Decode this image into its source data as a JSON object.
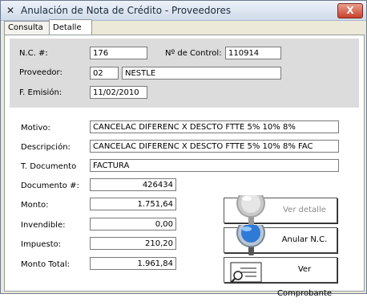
{
  "window": {
    "title": "Anulación de Nota de Crédito - Proveedores",
    "close_label": "X"
  },
  "tabs": [
    {
      "label": "Consulta"
    },
    {
      "label": "Detalle"
    }
  ],
  "header": {
    "nc_label": "N.C. #:",
    "nc_value": "176",
    "control_label": "Nº de Control:",
    "control_value": "110914",
    "proveedor_label": "Proveedor:",
    "proveedor_code": "02",
    "proveedor_name": "NESTLE",
    "emision_label": "F. Emisión:",
    "emision_value": "11/02/2010"
  },
  "details": {
    "motivo_label": "Motivo:",
    "motivo_value": "CANCELAC DIFERENC  X DESCTO FTTE 5% 10% 8%",
    "descripcion_label": "Descripción:",
    "descripcion_value": "CANCELAC DIFERENC  X DESCTO FTTE 5% 10% 8% FAC",
    "tdoc_label": "T. Documento",
    "tdoc_value": "FACTURA",
    "documento_label": "Documento #:",
    "documento_value": "426434",
    "monto_label": "Monto:",
    "monto_value": "1.751,64",
    "invendible_label": "Invendible:",
    "invendible_value": "0,00",
    "impuesto_label": "Impuesto:",
    "impuesto_value": "210,20",
    "total_label": "Monto Total:",
    "total_value": "1.961,84"
  },
  "buttons": {
    "ver_detalle": "Ver detalle",
    "anular": "Anular N.C.",
    "ver_comprobante": "Ver Comprobante"
  },
  "icons": {
    "window_icon": "x-mark-icon",
    "ver_detalle_icon": "magnifier-gray-icon",
    "anular_icon": "magnifier-blue-icon",
    "comprobante_icon": "document-magnifier-icon"
  },
  "colors": {
    "header_panel": "#dcdcdc",
    "anular_lens": "#2f7ad6",
    "close_button": "#c8412a"
  }
}
